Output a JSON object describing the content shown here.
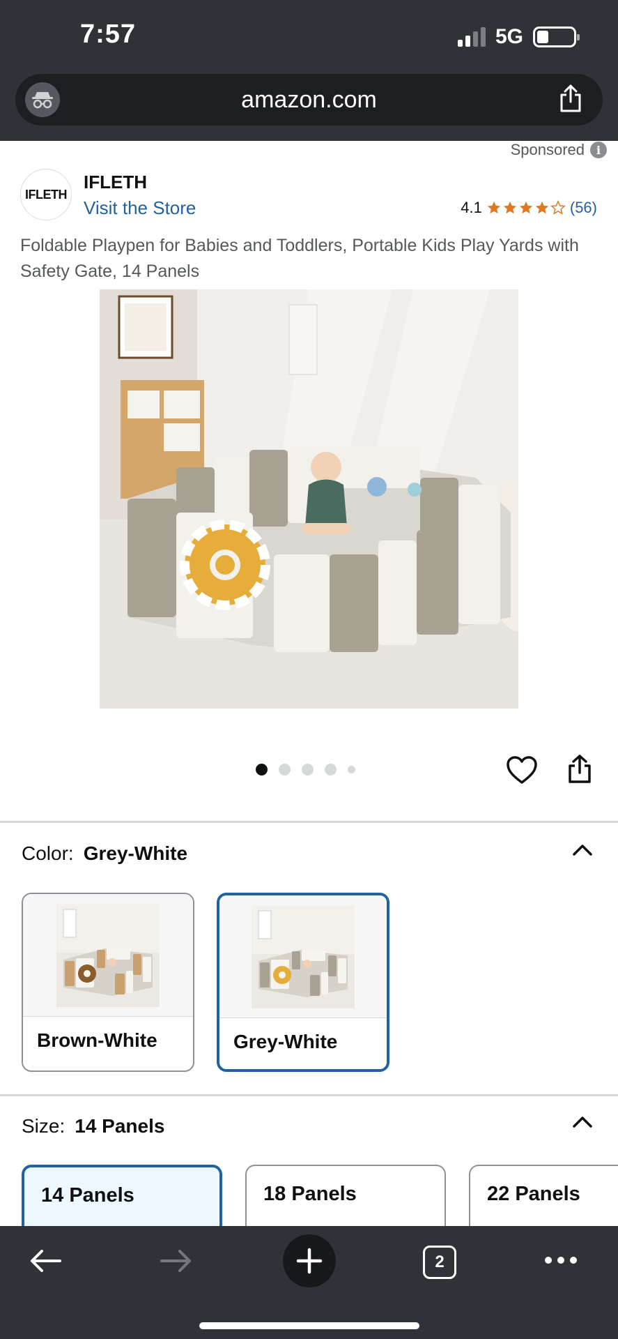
{
  "status_bar": {
    "time": "7:57",
    "network": "5G"
  },
  "browser": {
    "url": "amazon.com",
    "tab_count": "2"
  },
  "ad": {
    "sponsored_label": "Sponsored",
    "brand_logo_text": "IFLETH",
    "brand_name": "IFLETH",
    "store_link": "Visit the Store",
    "rating": "4.1",
    "rating_count": "(56)",
    "star_rating_value": 4.1,
    "title": "Foldable Playpen for Babies and Toddlers, Portable Kids Play Yards with Safety Gate, 14 Panels"
  },
  "gallery": {
    "image_count": 5,
    "active_index": 0
  },
  "color": {
    "label": "Color:",
    "selected": "Grey-White",
    "options": [
      {
        "label": "Brown-White"
      },
      {
        "label": "Grey-White"
      }
    ]
  },
  "size": {
    "label": "Size:",
    "selected": "14 Panels",
    "options": [
      {
        "label": "14 Panels"
      },
      {
        "label": "18 Panels"
      },
      {
        "label": "22 Panels"
      }
    ]
  },
  "colors": {
    "accent": "#2162a1",
    "star": "#de7921",
    "chrome": "#2f3338"
  }
}
